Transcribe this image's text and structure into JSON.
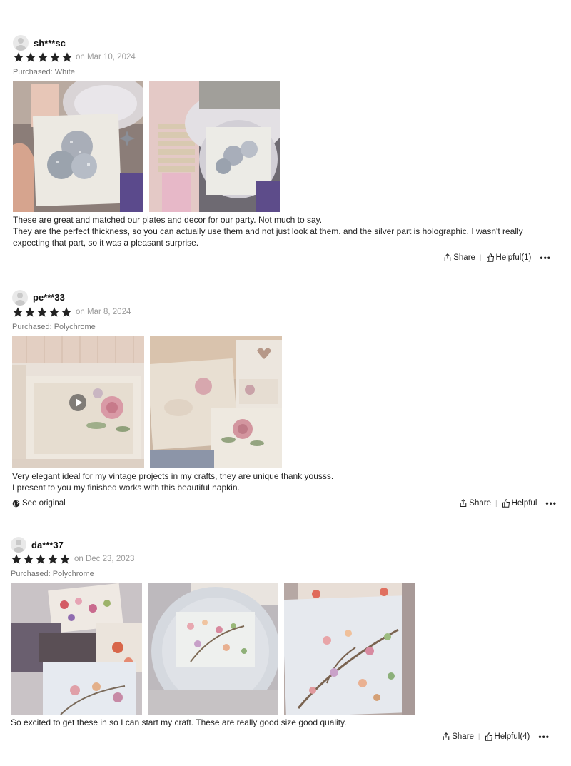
{
  "reviews": [
    {
      "username": "sh***sc",
      "rating": 5,
      "date": "on Mar 10, 2024",
      "purchased": "Purchased: White",
      "text_lines": [
        "These are great and matched our plates and decor for our party. Not much to say.",
        "They are the perfect thickness, so you can actually use them and not just look at them. and the silver part is holographic. I wasn't really expecting that part, so it was a pleasant surprise."
      ],
      "share_label": "Share",
      "helpful_label": "Helpful(1)",
      "more_label": "•••"
    },
    {
      "username": "pe***33",
      "rating": 5,
      "date": "on Mar 8, 2024",
      "purchased": "Purchased: Polychrome",
      "text_lines": [
        "Very elegant ideal for my vintage projects in my crafts, they are unique thank yousss.",
        "I present to you my finished works with this beautiful napkin."
      ],
      "see_original_label": "See original",
      "share_label": "Share",
      "helpful_label": "Helpful",
      "more_label": "•••"
    },
    {
      "username": "da***37",
      "rating": 5,
      "date": "on Dec 23, 2023",
      "purchased": "Purchased: Polychrome",
      "text_lines": [
        "So excited to get these in so I can start my craft. These are really good size good quality."
      ],
      "share_label": "Share",
      "helpful_label": "Helpful(4)",
      "more_label": "•••"
    }
  ],
  "colors": {
    "star": "#222222",
    "muted_text": "#9a9a9a",
    "body_text": "#222222"
  },
  "icons": [
    "avatar-placeholder",
    "star-icon",
    "share-icon",
    "thumbs-up-icon",
    "globe-icon",
    "play-icon",
    "more-icon"
  ]
}
